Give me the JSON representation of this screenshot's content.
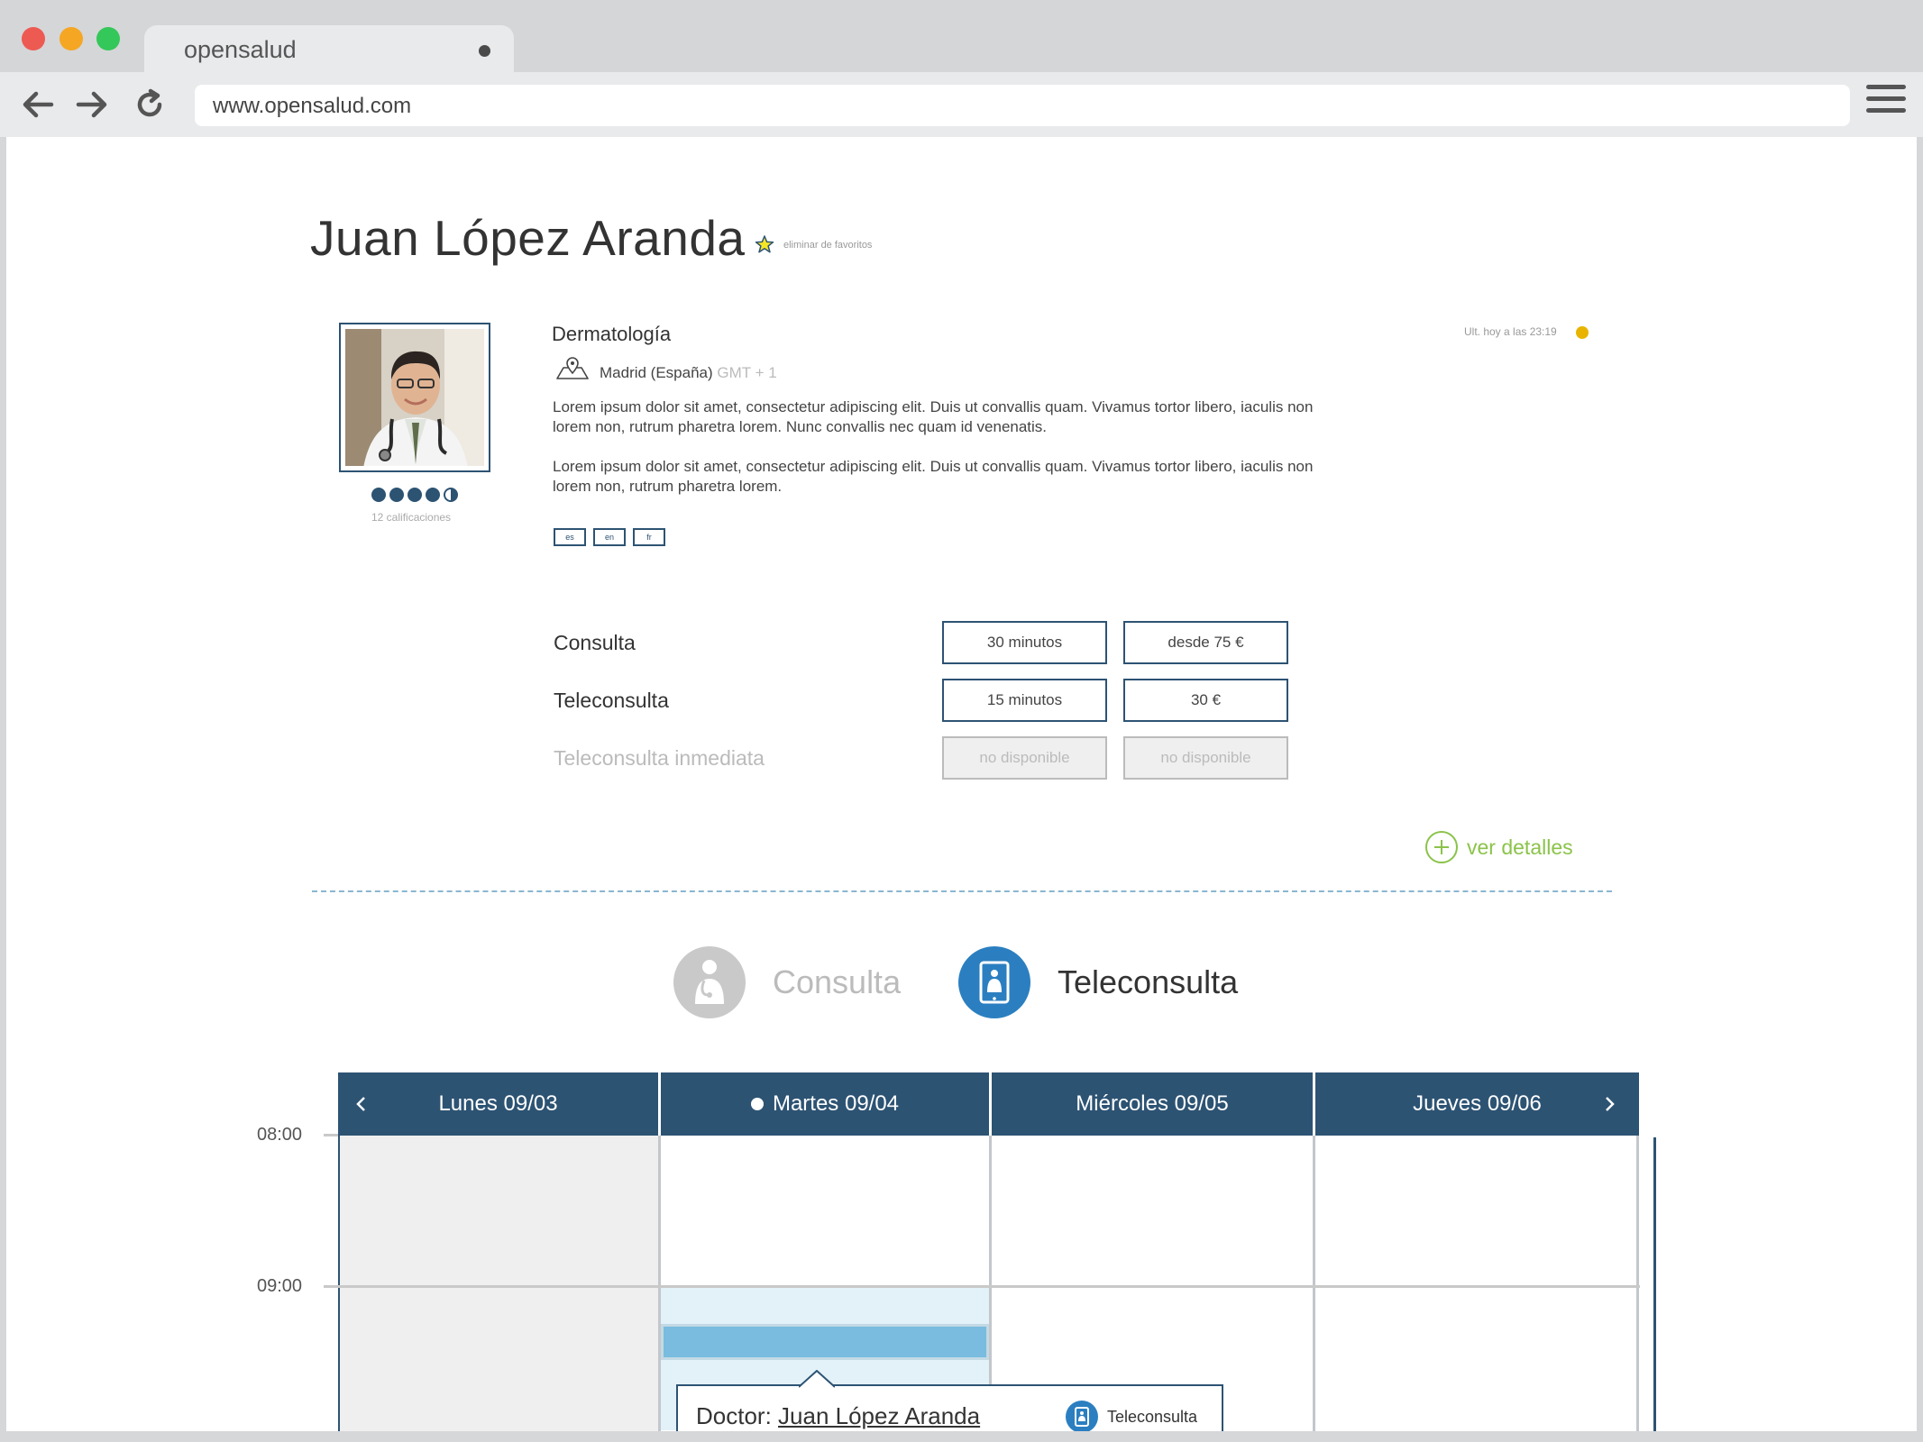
{
  "browser": {
    "tab_title": "opensalud",
    "url": "www.opensalud.com"
  },
  "profile": {
    "name": "Juan López Aranda",
    "favorite_action": "eliminar de favoritos",
    "specialty": "Dermatología",
    "location": "Madrid (España)",
    "timezone": "GMT + 1",
    "bio_1": "Lorem ipsum dolor sit amet, consectetur adipiscing elit. Duis ut convallis quam. Vivamus tortor libero, iaculis non lorem non, rutrum pharetra lorem. Nunc convallis nec quam id venenatis.",
    "bio_2": "Lorem ipsum dolor sit amet, consectetur adipiscing elit. Duis ut convallis quam. Vivamus tortor libero, iaculis non lorem non, rutrum pharetra lorem.",
    "rating": 4.5,
    "rating_count": "12 calificaciones",
    "languages": [
      "es",
      "en",
      "fr"
    ],
    "last_seen": "Ult. hoy a las 23:19",
    "status_color": "#e8b400"
  },
  "services": [
    {
      "label": "Consulta",
      "duration": "30 minutos",
      "price": "desde 75 €",
      "available": true
    },
    {
      "label": "Teleconsulta",
      "duration": "15 minutos",
      "price": "30 €",
      "available": true
    },
    {
      "label": "Teleconsulta inmediata",
      "duration": "no disponible",
      "price": "no disponible",
      "available": false
    }
  ],
  "details_link": "ver detalles",
  "modes": {
    "consulta": "Consulta",
    "teleconsulta": "Teleconsulta",
    "selected": "teleconsulta"
  },
  "calendar": {
    "days": [
      "Lunes 09/03",
      "Martes 09/04",
      "Miércoles 09/05",
      "Jueves 09/06"
    ],
    "today_index": 1,
    "times": [
      "08:00",
      "09:00"
    ],
    "popup_prefix": "Doctor: ",
    "popup_doctor": "Juan López Aranda",
    "popup_mode": "Teleconsulta"
  },
  "colors": {
    "primary": "#2d5373",
    "accent_blue": "#2b7fc0",
    "green": "#8bc34a",
    "slot_light": "#e3f1f9",
    "slot_selected": "#79bcdf"
  }
}
